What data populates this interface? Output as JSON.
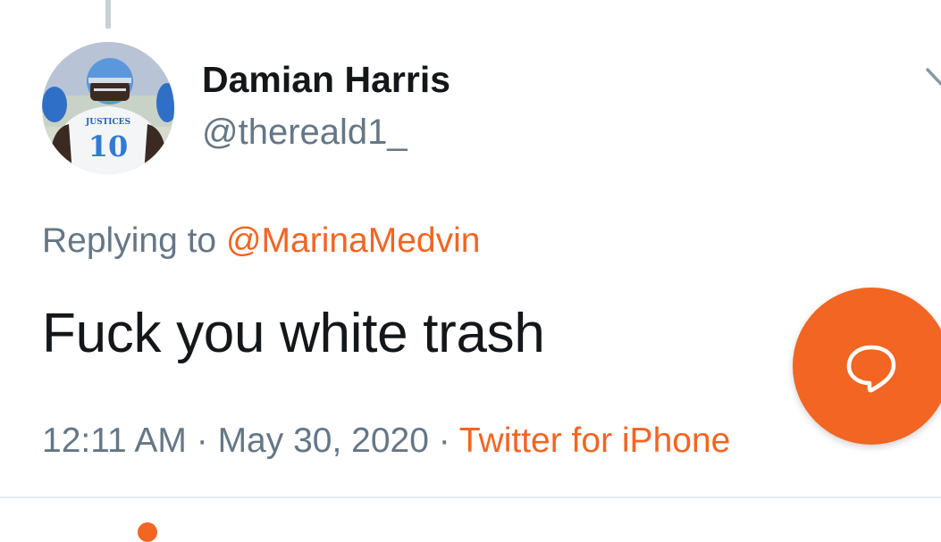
{
  "tweet": {
    "author": {
      "display_name": "Damian Harris",
      "handle": "@thereald1_",
      "avatar": {
        "icon": "avatar-football-player",
        "jersey_text": "JUSTICES",
        "jersey_number": "10"
      }
    },
    "replying": {
      "prefix": "Replying to ",
      "mention": "@MarinaMedvin"
    },
    "text": "Fuck you white trash",
    "meta": {
      "time": "12:11 AM",
      "separator1": " · ",
      "date": "May 30, 2020",
      "separator2": " · ",
      "source": "Twitter for iPhone"
    }
  },
  "icons": {
    "menu": "chevron-down-icon",
    "fab": "reply-bubble-icon"
  },
  "colors": {
    "accent": "#f26522",
    "text_primary": "#14171a",
    "text_secondary": "#657786",
    "divider": "#e6ecf0"
  }
}
